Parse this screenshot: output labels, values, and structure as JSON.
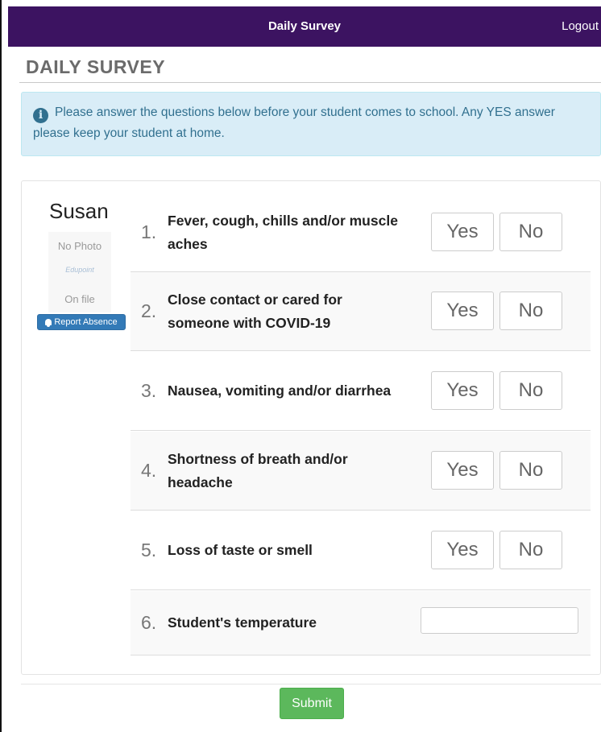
{
  "header": {
    "title": "Daily Survey",
    "logout_label": "Logout"
  },
  "page": {
    "title": "DAILY SURVEY"
  },
  "alert": {
    "icon": "info-icon",
    "message": "Please answer the questions below before your student comes to school. Any YES answer please keep your student at home."
  },
  "student": {
    "name": "Susan",
    "photo": {
      "line1": "No Photo",
      "logo": "Edupoint",
      "line2": "On file"
    },
    "report_absence_label": "Report Absence",
    "report_absence_icon": "bell-icon"
  },
  "questions": [
    {
      "number": "1.",
      "text": "Fever, cough, chills and/or muscle aches",
      "yes_label": "Yes",
      "no_label": "No"
    },
    {
      "number": "2.",
      "text": "Close contact or cared for someone with COVID-19",
      "yes_label": "Yes",
      "no_label": "No"
    },
    {
      "number": "3.",
      "text": "Nausea, vomiting and/or diarrhea",
      "yes_label": "Yes",
      "no_label": "No"
    },
    {
      "number": "4.",
      "text": "Shortness of breath and/or headache",
      "yes_label": "Yes",
      "no_label": "No"
    },
    {
      "number": "5.",
      "text": "Loss of taste or smell",
      "yes_label": "Yes",
      "no_label": "No"
    }
  ],
  "temperature": {
    "number": "6.",
    "text": "Student's temperature",
    "value": "",
    "placeholder": ""
  },
  "submit_label": "Submit",
  "colors": {
    "header_bg": "#3c1361",
    "alert_bg": "#d9edf7",
    "alert_text": "#31708f",
    "report_button": "#337ab7",
    "submit_button": "#5cb85c"
  }
}
